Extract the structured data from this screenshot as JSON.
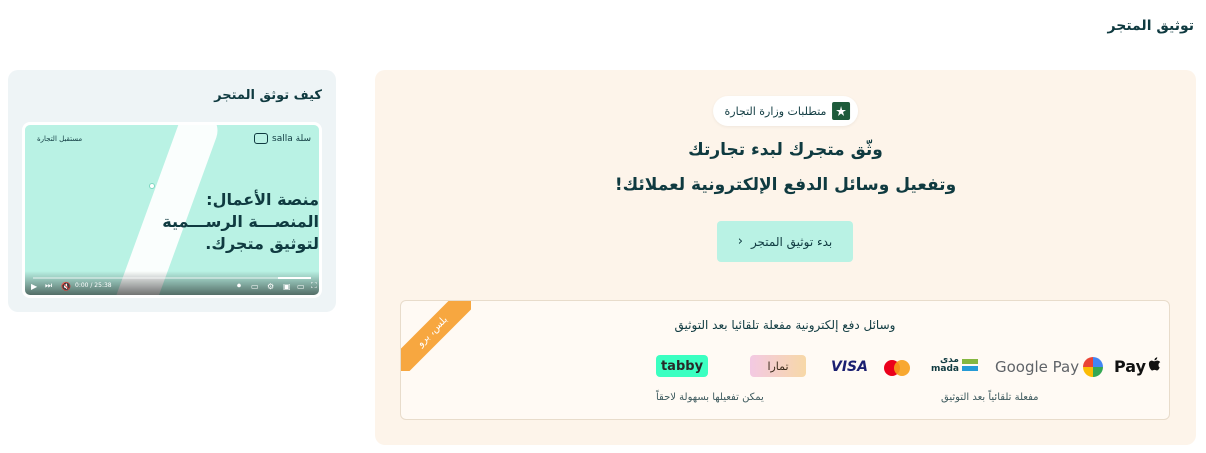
{
  "page": {
    "title": "توثيق المتجر"
  },
  "verification": {
    "ministry_badge": "متطلبات وزارة التجارة",
    "headline_line1": "وثّق متجرك لبدء تجارتك",
    "headline_line2": "وتفعيل وسائل الدفع الإلكترونية لعملائك!",
    "cta_label": "بدء توثيق المتجر",
    "cta_icon": "chevron-left-icon"
  },
  "payments": {
    "title": "وسائل دفع إلكترونية مفعلة تلقائيا بعد التوثيق",
    "ribbon": "بلس، برو",
    "auto_methods": [
      {
        "name": "Apple Pay",
        "label": "Pay",
        "icon": "apple-icon"
      },
      {
        "name": "Google Pay",
        "label": "Google Pay",
        "icon": "google-g-icon"
      },
      {
        "name": "mada",
        "label_ar": "مدى",
        "label_en": "mada"
      },
      {
        "name": "Mastercard"
      },
      {
        "name": "Visa",
        "label": "VISA"
      }
    ],
    "optional_methods": [
      {
        "name": "Tamara",
        "label": "تمارا"
      },
      {
        "name": "Tabby",
        "label": "tabby"
      }
    ],
    "auto_note": "مفعلة تلقائياً بعد التوثيق",
    "optional_note": "يمكن تفعيلها بسهولة لاحقاً"
  },
  "howto": {
    "title": "كيف توثق المتجر",
    "video": {
      "brand": "سلة salla",
      "tag": "مستقبل التجارة",
      "headline_line1": "منصة الأعمال:",
      "headline_line2": "المنصـــة الرســـمية",
      "headline_line3": "لتوثيق متجرك.",
      "time": "0:00 / 25:38",
      "progress": 0.12
    }
  },
  "colors": {
    "accent": "#b9f2e4",
    "text": "#0f3a40",
    "card_bg": "#fdf4ea",
    "ribbon": "#f7a740"
  }
}
